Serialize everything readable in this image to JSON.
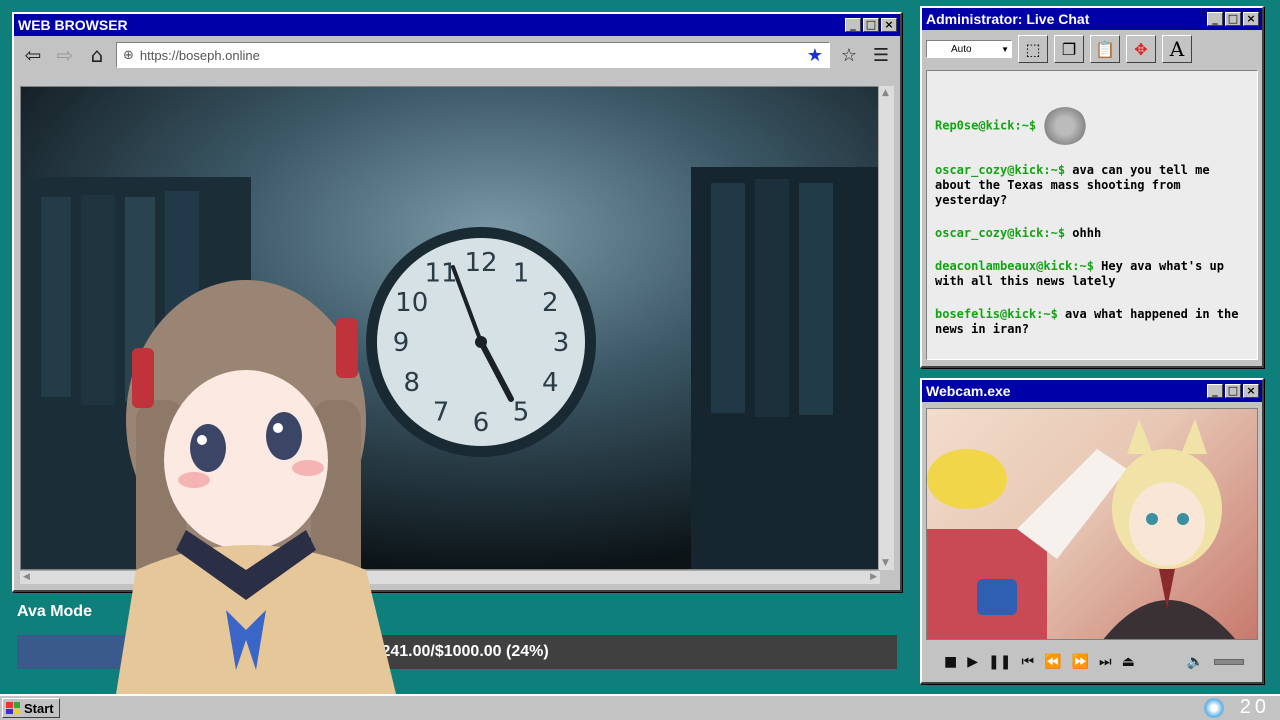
{
  "browser": {
    "title": "WEB BROWSER",
    "url": "https://boseph.online",
    "video_clock_numbers": [
      "12",
      "1",
      "2",
      "3",
      "4",
      "5",
      "6",
      "7",
      "8",
      "9",
      "10",
      "11"
    ]
  },
  "goal": {
    "label": "Ava Mode",
    "text": ",241.00/$1000.00 (24%)",
    "fraction": 0.24
  },
  "chat": {
    "title": "Administrator: Live Chat",
    "select_value": "Auto",
    "messages": [
      {
        "user": "Rep0se@kick:~$",
        "text": ""
      },
      {
        "user": "oscar_cozy@kick:~$",
        "text": " ava can you tell me about the Texas mass shooting from yesterday?"
      },
      {
        "user": "oscar_cozy@kick:~$",
        "text": " ohhh"
      },
      {
        "user": "deaconlambeaux@kick:~$",
        "text": " Hey ava what's up with all this news lately"
      },
      {
        "user": "bosefelis@kick:~$",
        "text": " ava what happened in the news in iran?"
      }
    ]
  },
  "webcam": {
    "title": "Webcam.exe"
  },
  "taskbar": {
    "start_label": "Start",
    "clock": "20"
  },
  "colors": {
    "desktop": "#0f7f7b",
    "titlebar": "#0000a8",
    "chat_user": "#14a314",
    "progress_fill": "#3a5a8c"
  }
}
